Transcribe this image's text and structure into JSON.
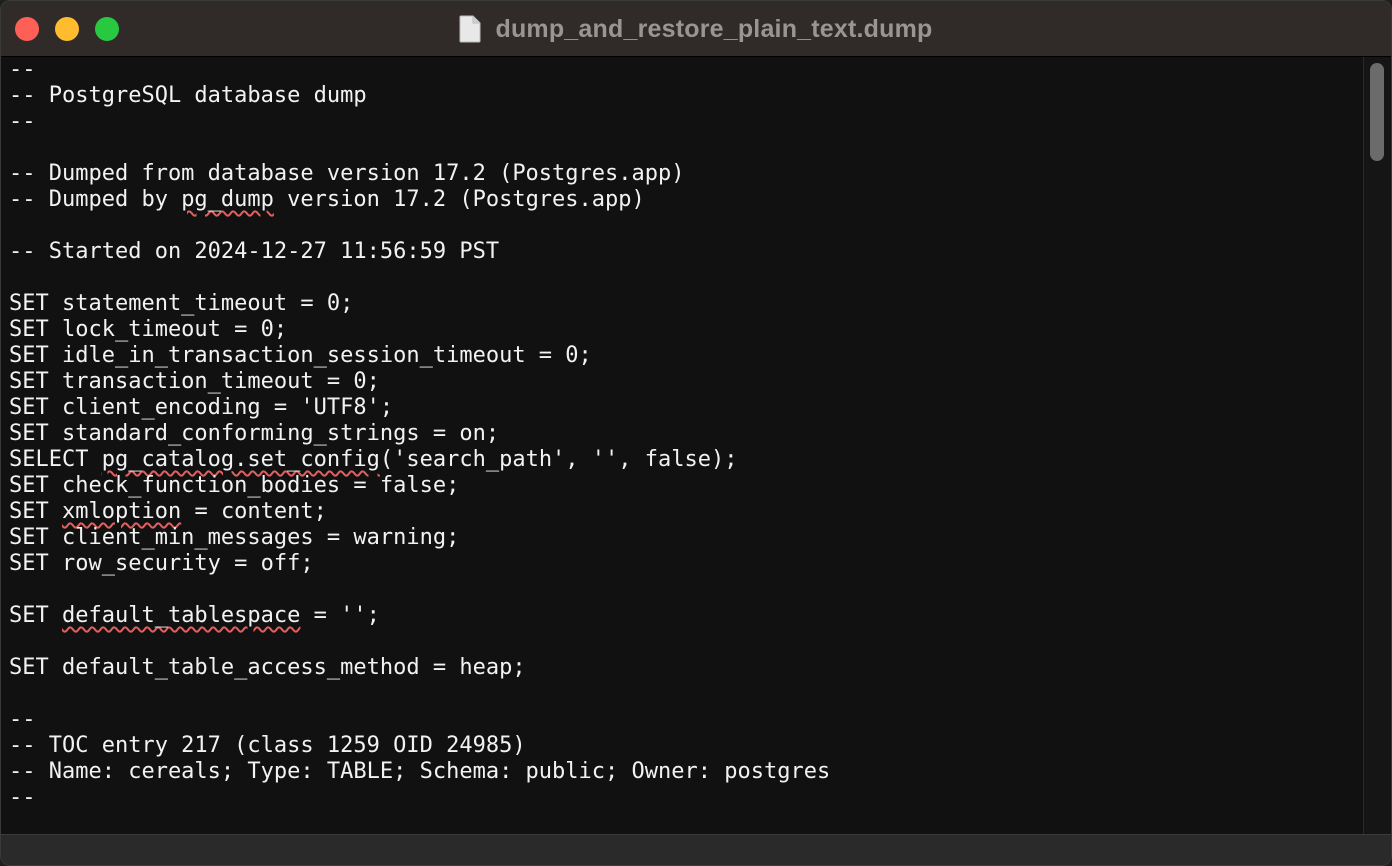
{
  "window": {
    "title": "dump_and_restore_plain_text.dump",
    "controls": {
      "close_color": "#fe5f57",
      "minimize_color": "#febc2e",
      "zoom_color": "#28c840"
    }
  },
  "editor": {
    "lines": [
      {
        "segments": [
          {
            "text": "--"
          }
        ]
      },
      {
        "segments": [
          {
            "text": "-- PostgreSQL database dump"
          }
        ]
      },
      {
        "segments": [
          {
            "text": "--"
          }
        ]
      },
      {
        "segments": [
          {
            "text": ""
          }
        ]
      },
      {
        "segments": [
          {
            "text": "-- Dumped from database version 17.2 (Postgres.app)"
          }
        ]
      },
      {
        "segments": [
          {
            "text": "-- Dumped by "
          },
          {
            "text": "pg_dump",
            "misspelled": true
          },
          {
            "text": " version 17.2 (Postgres.app)"
          }
        ]
      },
      {
        "segments": [
          {
            "text": ""
          }
        ]
      },
      {
        "segments": [
          {
            "text": "-- Started on 2024-12-27 11:56:59 PST"
          }
        ]
      },
      {
        "segments": [
          {
            "text": ""
          }
        ]
      },
      {
        "segments": [
          {
            "text": "SET statement_timeout = 0;"
          }
        ]
      },
      {
        "segments": [
          {
            "text": "SET lock_timeout = 0;"
          }
        ]
      },
      {
        "segments": [
          {
            "text": "SET idle_in_transaction_session_timeout = 0;"
          }
        ]
      },
      {
        "segments": [
          {
            "text": "SET transaction_timeout = 0;"
          }
        ]
      },
      {
        "segments": [
          {
            "text": "SET client_encoding = 'UTF8';"
          }
        ]
      },
      {
        "segments": [
          {
            "text": "SET standard_conforming_strings = on;"
          }
        ]
      },
      {
        "segments": [
          {
            "text": "SELECT "
          },
          {
            "text": "pg_catalog.set_config",
            "misspelled": true
          },
          {
            "text": "('search_path', '', false);"
          }
        ]
      },
      {
        "segments": [
          {
            "text": "SET check_function_bodies = false;"
          }
        ]
      },
      {
        "segments": [
          {
            "text": "SET "
          },
          {
            "text": "xmloption",
            "misspelled": true
          },
          {
            "text": " = content;"
          }
        ]
      },
      {
        "segments": [
          {
            "text": "SET client_min_messages = warning;"
          }
        ]
      },
      {
        "segments": [
          {
            "text": "SET row_security = off;"
          }
        ]
      },
      {
        "segments": [
          {
            "text": ""
          }
        ]
      },
      {
        "segments": [
          {
            "text": "SET "
          },
          {
            "text": "default_tablespace",
            "misspelled": true
          },
          {
            "text": " = '';"
          }
        ]
      },
      {
        "segments": [
          {
            "text": ""
          }
        ]
      },
      {
        "segments": [
          {
            "text": "SET default_table_access_method = heap;"
          }
        ]
      },
      {
        "segments": [
          {
            "text": ""
          }
        ]
      },
      {
        "segments": [
          {
            "text": "--"
          }
        ]
      },
      {
        "segments": [
          {
            "text": "-- TOC entry 217 (class 1259 OID 24985)"
          }
        ]
      },
      {
        "segments": [
          {
            "text": "-- Name: cereals; Type: TABLE; Schema: public; Owner: postgres"
          }
        ]
      },
      {
        "segments": [
          {
            "text": "--"
          }
        ]
      }
    ],
    "text_color": "#f2f2f2",
    "background_color": "#111111",
    "spellcheck_color": "#e06060"
  },
  "icons": {
    "title_icon": "document-icon"
  }
}
